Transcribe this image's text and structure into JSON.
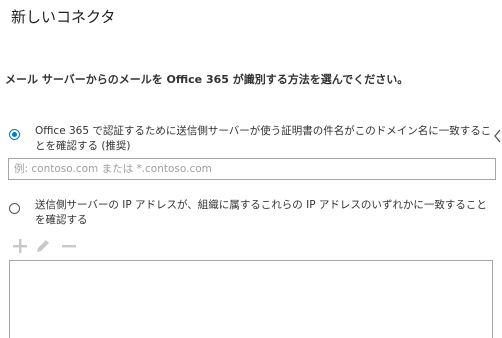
{
  "window": {
    "title": "新しいコネクタ"
  },
  "instruction": "メール サーバーからのメールを Office 365 が識別する方法を選んでください。",
  "options": [
    {
      "label": "Office 365 で認証するために送信側サーバーが使う証明書の件名がこのドメイン名に一致することを確認する (推奨)",
      "selected": true
    },
    {
      "label": "送信側サーバーの IP アドレスが、組織に属するこれらの IP アドレスのいずれかに一致することを確認する",
      "selected": false
    }
  ],
  "domain_input": {
    "value": "",
    "placeholder": "例: contoso.com または *.contoso.com"
  },
  "toolbar": {
    "add_icon": "plus-icon",
    "edit_icon": "pencil-icon",
    "remove_icon": "minus-icon",
    "enabled": false
  },
  "colors": {
    "accent": "#0078d4",
    "disabled_icon": "#c8c8c8",
    "border": "#a6a6a6"
  }
}
